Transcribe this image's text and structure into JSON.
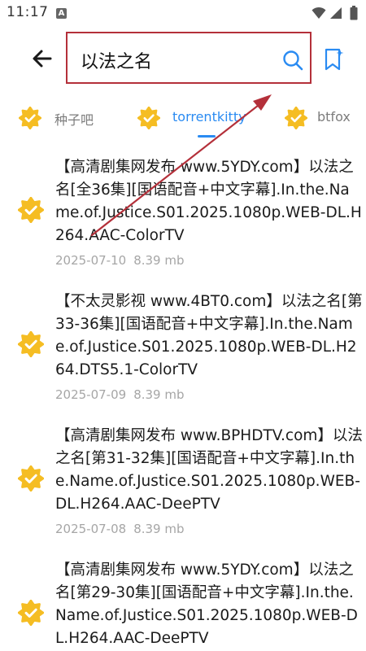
{
  "status_bar": {
    "time": "11:17",
    "notification_glyph": "A"
  },
  "header": {
    "search_query": "以法之名",
    "back_icon": "arrow-left-icon",
    "search_icon": "magnifier-icon",
    "bookmark_icon": "bookmark-star-icon"
  },
  "tabs": [
    {
      "label": "种子吧",
      "active": false
    },
    {
      "label": "torrentkitty",
      "active": true
    },
    {
      "label": "btfox",
      "active": false
    }
  ],
  "results": [
    {
      "title": "【高清剧集网发布 www.5YDY.com】以法之名[全36集][国语配音+中文字幕].In.the.Name.of.Justice.S01.2025.1080p.WEB-DL.H264.AAC-ColorTV",
      "date": "2025-07-10",
      "size": "8.39 mb"
    },
    {
      "title": "【不太灵影视 www.4BT0.com】以法之名[第33-36集][国语配音+中文字幕].In.the.Name.of.Justice.S01.2025.1080p.WEB-DL.H264.DTS5.1-ColorTV",
      "date": "2025-07-09",
      "size": "8.39 mb"
    },
    {
      "title": "【高清剧集网发布 www.BPHDTV.com】以法之名[第31-32集][国语配音+中文字幕].In.the.Name.of.Justice.S01.2025.1080p.WEB-DL.H264.AAC-DeePTV",
      "date": "2025-07-08",
      "size": "8.39 mb"
    },
    {
      "title": "【高清剧集网发布 www.5YDY.com】以法之名[第29-30集][国语配音+中文字幕].In.the.Name.of.Justice.S01.2025.1080p.WEB-DL.H264.AAC-DeePTV",
      "date": "",
      "size": ""
    }
  ],
  "colors": {
    "accent_blue": "#2a8bf2",
    "badge_yellow": "#f5bd23",
    "annotation_red": "#b4303a",
    "meta_gray": "#a6a6a6"
  }
}
